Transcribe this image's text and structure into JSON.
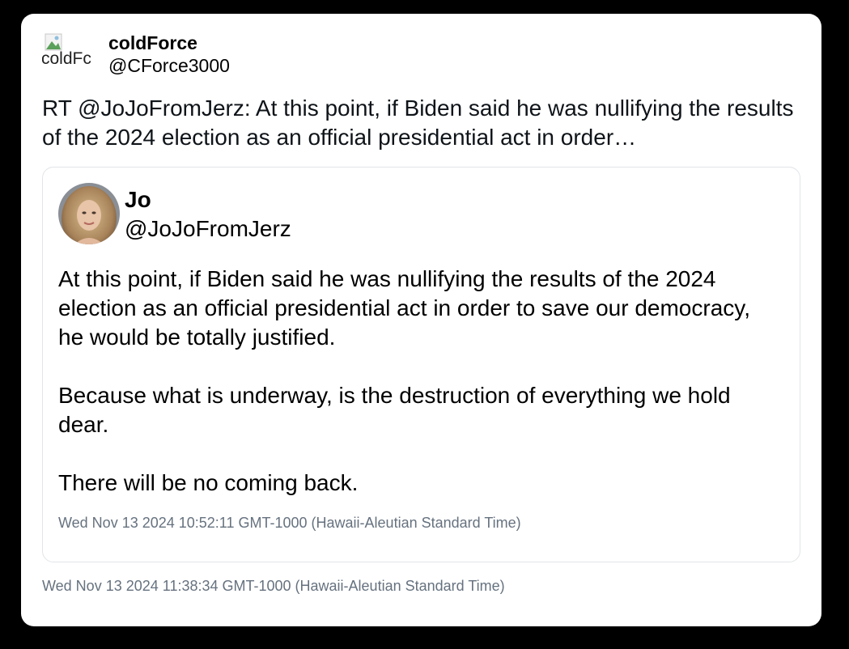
{
  "tweet": {
    "author": {
      "display_name": "coldForce",
      "handle": "@CForce3000",
      "avatar_alt": "coldFc"
    },
    "text": "RT @JoJoFromJerz: At this point, if Biden said he was nullifying the results of the 2024 election as an official presidential act in order…",
    "timestamp": "Wed Nov 13 2024 11:38:34 GMT-1000 (Hawaii-Aleutian Standard Time)"
  },
  "quoted": {
    "author": {
      "display_name": "Jo",
      "handle": "@JoJoFromJerz"
    },
    "paragraphs": [
      "At this point, if Biden said he was nullifying the results of the 2024 election as an official presidential act in order to save our democracy, he would be totally justified.",
      "Because what is underway, is the destruction of everything we hold dear.",
      "There will be no coming back."
    ],
    "timestamp": "Wed Nov 13 2024 10:52:11 GMT-1000 (Hawaii-Aleutian Standard Time)"
  },
  "colors": {
    "background": "#000000",
    "card": "#ffffff",
    "muted_text": "#66727f",
    "border": "#e1e4e8"
  }
}
